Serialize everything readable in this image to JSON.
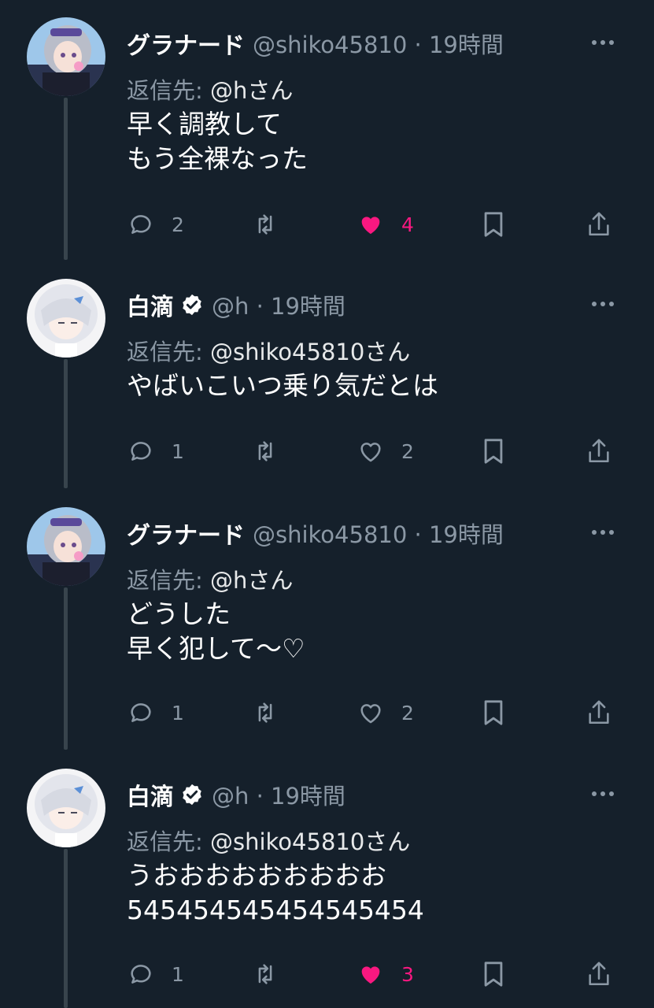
{
  "colors": {
    "background": "#15202b",
    "secondary_text": "#8b98a5",
    "like_active": "#f91880",
    "thread_line": "#38444d"
  },
  "tweets": [
    {
      "name": "グラナード",
      "handle_line": "@shiko45810 · 19時間",
      "verified": false,
      "reply_prefix": "返信先: ",
      "reply_mention": "@hさん",
      "text": "早く調教して\nもう全裸なった",
      "replies": "2",
      "likes": "4",
      "liked": true,
      "avatar": "gray-haired-avatar"
    },
    {
      "name": "白滴",
      "handle_line": "@h · 19時間",
      "verified": true,
      "reply_prefix": "返信先: ",
      "reply_mention": "@shiko45810さん",
      "text": "やばいこいつ乗り気だとは",
      "replies": "1",
      "likes": "2",
      "liked": false,
      "avatar": "white-haired-avatar"
    },
    {
      "name": "グラナード",
      "handle_line": "@shiko45810 · 19時間",
      "verified": false,
      "reply_prefix": "返信先: ",
      "reply_mention": "@hさん",
      "text": "どうした\n早く犯して〜♡",
      "replies": "1",
      "likes": "2",
      "liked": false,
      "avatar": "gray-haired-avatar"
    },
    {
      "name": "白滴",
      "handle_line": "@h · 19時間",
      "verified": true,
      "reply_prefix": "返信先: ",
      "reply_mention": "@shiko45810さん",
      "text": "うおおおおおおおおお\n545454545454545454",
      "replies": "1",
      "likes": "3",
      "liked": true,
      "avatar": "white-haired-avatar"
    }
  ]
}
